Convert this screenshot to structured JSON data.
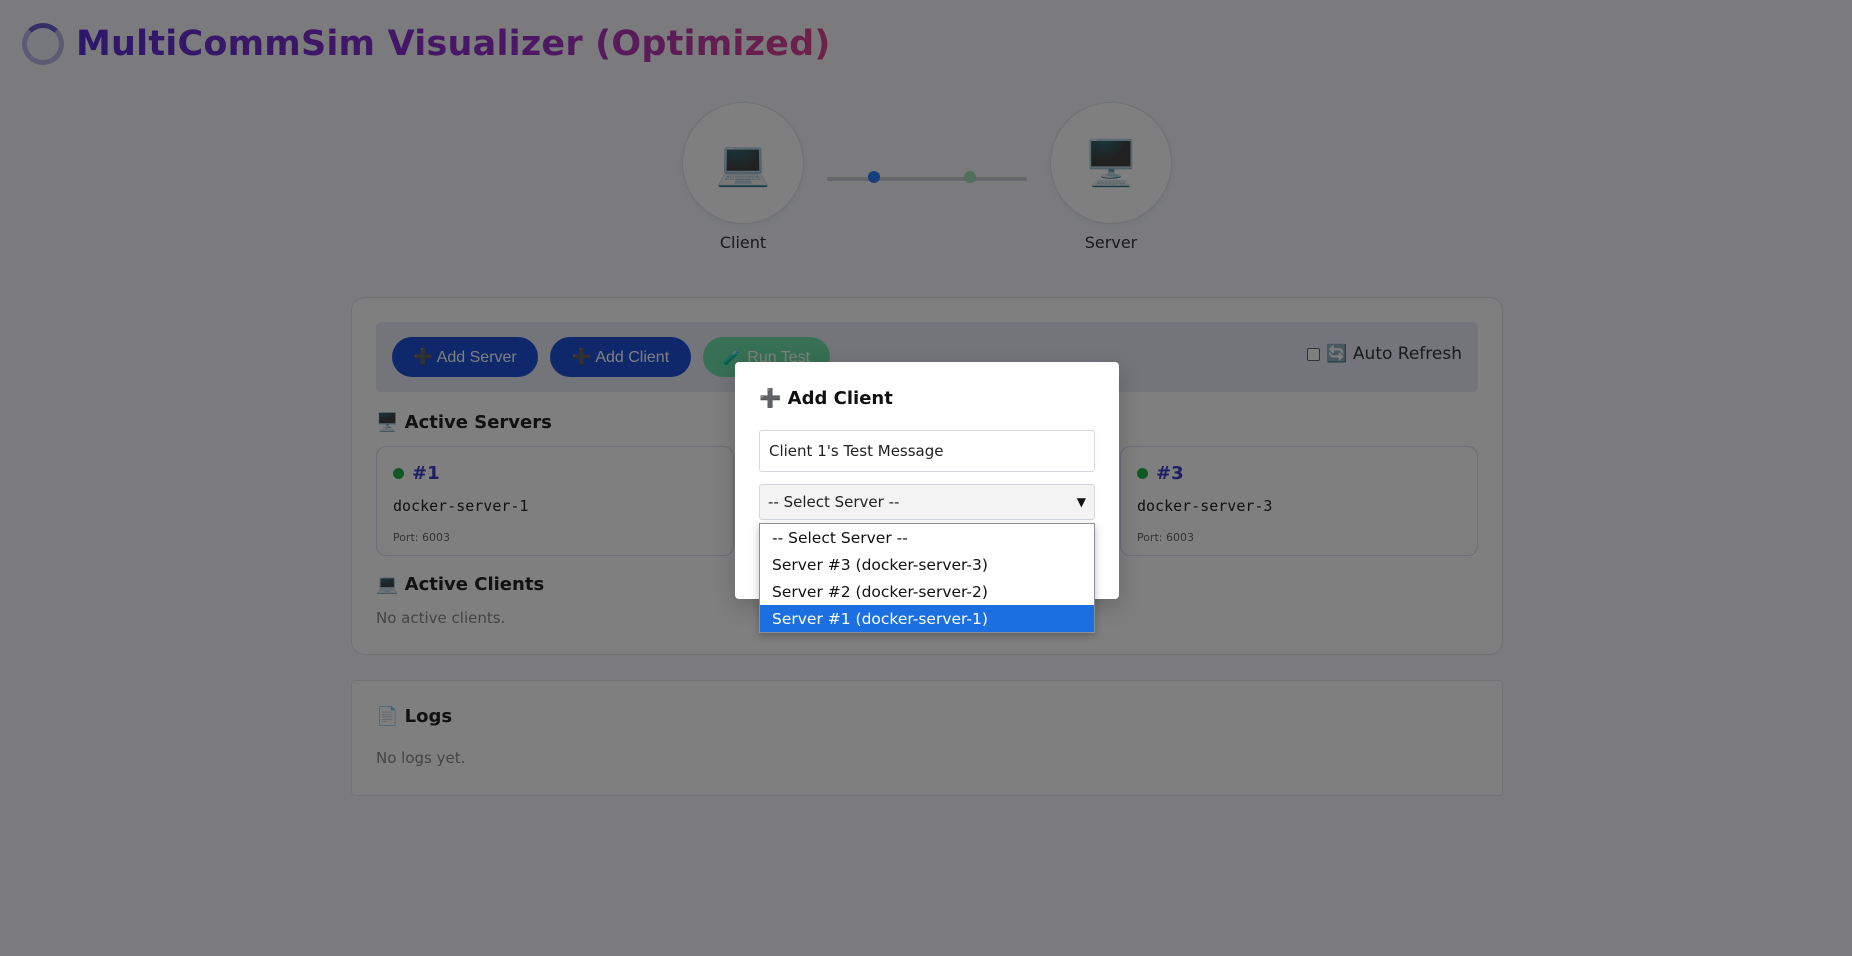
{
  "app": {
    "title": "MultiCommSim Visualizer (Optimized)"
  },
  "topology": {
    "client_label": "Client",
    "server_label": "Server",
    "client_icon": "💻",
    "server_icon": "🖥️"
  },
  "toolbar": {
    "add_server": "➕ Add Server",
    "add_client": "➕ Add Client",
    "run_test": "🧪 Run Test",
    "auto_refresh": "🔄 Auto Refresh",
    "auto_refresh_checked": false
  },
  "servers_section": {
    "title": "🖥️ Active Servers",
    "cards": [
      {
        "id": "#1",
        "name": "docker-server-1",
        "port": "Port: 6003",
        "status": "online"
      },
      {
        "id": "#3",
        "name": "docker-server-3",
        "port": "Port: 6003",
        "status": "online"
      }
    ]
  },
  "clients_section": {
    "title": "💻 Active Clients",
    "empty": "No active clients."
  },
  "logs": {
    "title": "📄 Logs",
    "empty": "No logs yet."
  },
  "modal": {
    "title": "➕ Add Client",
    "message_value": "Client 1's Test Message",
    "select_value": "-- Select Server --",
    "options": [
      "-- Select Server --",
      "Server #3 (docker-server-3)",
      "Server #2 (docker-server-2)",
      "Server #1 (docker-server-1)"
    ],
    "highlighted_option": "Server #1 (docker-server-1)"
  },
  "colors": {
    "primary_button": "#1f4fd6",
    "run_test_button": "#6fe0a8",
    "online_dot": "#22b04a",
    "selected_option": "#1b6fe0"
  }
}
